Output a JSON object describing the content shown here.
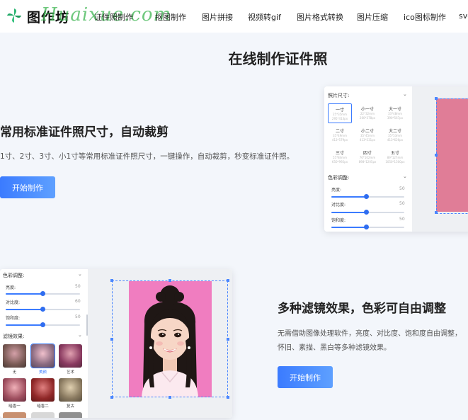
{
  "header": {
    "logo_text": "图作坊",
    "watermark": "Huaixue.com",
    "nav": [
      "证件照制作",
      "抠图制作",
      "图片拼接",
      "视频转gif",
      "图片格式转换",
      "图片压缩",
      "ico图标制作",
      "svg"
    ]
  },
  "main_title": "在线制作证件照",
  "section1": {
    "heading": "常用标准证件照尺寸，自动裁剪",
    "desc": "1寸、2寸、3寸、小1寸等常用标准证件照尺寸，一键操作，自动裁剪，秒变标准证件照。",
    "button": "开始制作",
    "panel": {
      "size_label": "照片尺寸:",
      "sizes": [
        {
          "name": "一寸",
          "dim1": "25*35mm",
          "dim2": "295*413px"
        },
        {
          "name": "小一寸",
          "dim1": "22*32mm",
          "dim2": "260*378px"
        },
        {
          "name": "大一寸",
          "dim1": "33*48mm",
          "dim2": "390*567px"
        },
        {
          "name": "二寸",
          "dim1": "35*49mm",
          "dim2": "413*579px"
        },
        {
          "name": "小二寸",
          "dim1": "35*45mm",
          "dim2": "413*531px"
        },
        {
          "name": "大二寸",
          "dim1": "35*53mm",
          "dim2": "413*626px"
        },
        {
          "name": "三寸",
          "dim1": "55*84mm",
          "dim2": "650*992px"
        },
        {
          "name": "四寸",
          "dim1": "76*102mm",
          "dim2": "898*1205px"
        },
        {
          "name": "五寸",
          "dim1": "89*127mm",
          "dim2": "1050*1500px"
        }
      ],
      "selected_size": 0,
      "color_label": "色彩调整:",
      "sliders": [
        {
          "label": "亮度:",
          "value": 50
        },
        {
          "label": "对比度:",
          "value": 50
        },
        {
          "label": "饱和度:",
          "value": 50
        }
      ]
    }
  },
  "section2": {
    "heading": "多种滤镜效果，色彩可自由调整",
    "desc": "无需借助图像处理软件，亮度、对比度、饱和度自由调整，怀旧、素描、黑白等多种滤镜效果。",
    "button": "开始制作",
    "panel": {
      "color_label": "色彩调整:",
      "sliders": [
        {
          "label": "亮度:",
          "value": 50
        },
        {
          "label": "对比度:",
          "value": 60
        },
        {
          "label": "饱和度:",
          "value": 50
        }
      ],
      "filter_label": "滤镜效果:",
      "filters": [
        "无",
        "美颜",
        "艺术",
        "暗香一",
        "暗香二",
        "复古"
      ],
      "selected_filter": 1,
      "colors": {
        "accent": "#3b7bff",
        "photo_pink": "#f07dc0"
      }
    }
  }
}
